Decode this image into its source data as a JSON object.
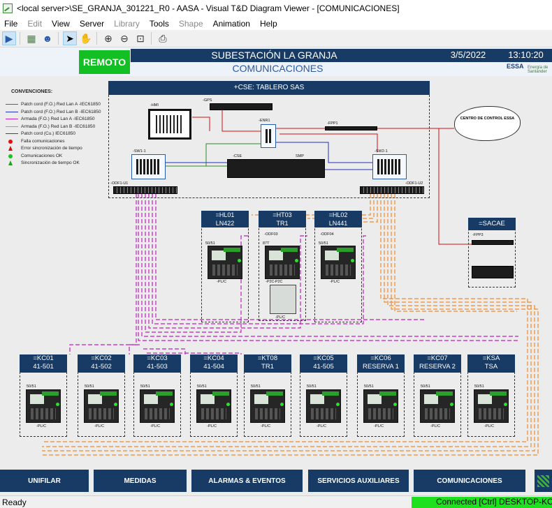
{
  "window": {
    "title": "<local server>\\SE_GRANJA_301221_R0 - AASA - Visual T&D Diagram Viewer - [COMUNICACIONES]"
  },
  "menu": {
    "file": "File",
    "edit": "Edit",
    "view": "View",
    "server": "Server",
    "library": "Library",
    "tools": "Tools",
    "shape": "Shape",
    "animation": "Animation",
    "help": "Help"
  },
  "toolbar": {
    "icons": [
      "play-icon",
      "diagram-icon",
      "users-icon",
      "pointer-icon",
      "hand-icon",
      "zoom-in-icon",
      "zoom-out-icon",
      "zoom-fit-icon",
      "print-icon"
    ]
  },
  "header": {
    "mode": "REMOTO",
    "station": "SUBESTACIÓN LA GRANJA",
    "page": "COMUNICACIONES",
    "date": "3/5/2022",
    "time": "13:10:20",
    "logo": "ESSA",
    "logo_small": "Energía de Santander"
  },
  "legend": {
    "title": "CONVENCIONES:",
    "items": [
      {
        "label": "Patch cord (F.O.) Red Lan A -IEC61850",
        "color": "#2a8a2a",
        "style": "solid"
      },
      {
        "label": "Patch cord (F.O.) Red Lan B -IEC61850",
        "color": "#2030c0",
        "style": "solid"
      },
      {
        "label": "Armada (F.O.) Red Lan A -IEC61850",
        "color": "#c020c0",
        "style": "solid"
      },
      {
        "label": "Armada (F.O.) Red Lan B -IEC61850",
        "color": "#f08a30",
        "style": "solid"
      },
      {
        "label": "Patch cord (Cu.) IEC61850",
        "color": "#d01010",
        "style": "solid"
      },
      {
        "label": "Falla comunicaciones",
        "color": "#e01010",
        "style": "dot"
      },
      {
        "label": "Error sincronización de tiempo",
        "color": "#d01010",
        "style": "tri"
      },
      {
        "label": "Comunicaciones OK",
        "color": "#20c020",
        "style": "dot"
      },
      {
        "label": "Sincronización de tiempo OK",
        "color": "#20a020",
        "style": "tri"
      }
    ]
  },
  "cabinet": {
    "title": "+CSE: TABLERO SAS",
    "hmi": "-HMI",
    "gps": "-GPS",
    "enr1": "-ENR1",
    "fpp1": "-FPP1",
    "sw1": "-SW1-1",
    "sw2": "-SW2-1",
    "cse": "-CSE",
    "smp": "SMP",
    "odf1": "-ODF1-U1",
    "odf2": "-ODF1-U2"
  },
  "cloud": {
    "label": "CENTRO DE CONTROL ESSA"
  },
  "sacae": {
    "title": "=SACAE",
    "fpp": "-FPP3"
  },
  "mid_bays": [
    {
      "code": "=HL01",
      "name": "LN422",
      "odf": "",
      "relay": "50/51",
      "plc": "-PL/C"
    },
    {
      "code": "=HT03",
      "name": "TR1",
      "odf": "-ODF03",
      "relay": "87T",
      "plc": "-P2C",
      "plc2": "-PL/C"
    },
    {
      "code": "=HL02",
      "name": "LN441",
      "odf": "-ODF04",
      "relay": "50/51",
      "plc": "-PL/C"
    }
  ],
  "bottom_bays": [
    {
      "code": "=KC01",
      "name": "41-501",
      "relay": "50/51",
      "plc": "-PL/C"
    },
    {
      "code": "=KC02",
      "name": "41-502",
      "relay": "50/51",
      "plc": "-PL/C"
    },
    {
      "code": "=KC03",
      "name": "41-503",
      "relay": "50/51",
      "plc": "-PL/C"
    },
    {
      "code": "=KC04",
      "name": "41-504",
      "relay": "50/51",
      "plc": "-PL/C"
    },
    {
      "code": "=KT08",
      "name": "TR1",
      "relay": "50/51",
      "plc": "-PL/C"
    },
    {
      "code": "=KC05",
      "name": "41-505",
      "relay": "50/51",
      "plc": "-PL/C"
    },
    {
      "code": "=KC06",
      "name": "RESERVA 1",
      "relay": "50/51",
      "plc": "-PL/C"
    },
    {
      "code": "=KC07",
      "name": "RESERVA 2",
      "relay": "50/51",
      "plc": "-PL/C"
    },
    {
      "code": "=KSA",
      "name": "TSA",
      "relay": "50/51",
      "plc": "-PL/C"
    }
  ],
  "nav": {
    "unifilar": "UNIFILAR",
    "medidas": "MEDIDAS",
    "alarmas": "ALARMAS & EVENTOS",
    "servicios": "SERVICIOS AUXILIARES",
    "comunicaciones": "COMUNICACIONES"
  },
  "status": {
    "ready": "Ready",
    "connected": "Connected [Ctrl] DESKTOP-KOC"
  }
}
